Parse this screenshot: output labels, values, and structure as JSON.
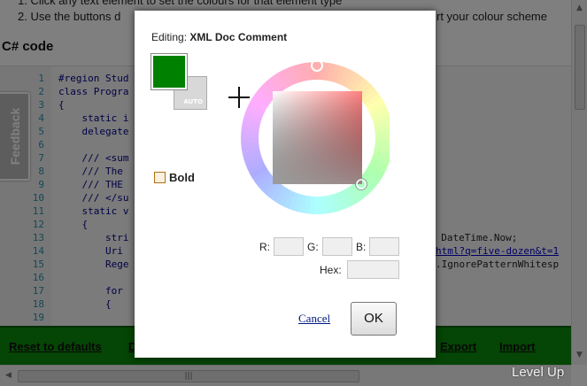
{
  "instructions": {
    "line1": "1.  Click any text element to set the colours for that element type",
    "line2_start": "2.  Use the buttons d",
    "line2_end": "rt your colour scheme"
  },
  "section_title": "C# code",
  "code": {
    "line_numbers": [
      "1",
      "2",
      "3",
      "4",
      "5",
      "6",
      "7",
      "8",
      "9",
      "10",
      "11",
      "12",
      "13",
      "14",
      "15",
      "16",
      "17",
      "18",
      "19"
    ],
    "lines": [
      "#region Stud",
      "class Progra",
      "{",
      "    static i",
      "    delegate",
      "",
      "    /// <sum",
      "    /// The ",
      "    /// THE ",
      "    /// </su",
      "    static v",
      "    {",
      "        stri",
      "        Uri ",
      "        Rege",
      "",
      "        for ",
      "        {",
      ""
    ],
    "right_line13": "+ DateTime.Now;",
    "right_line14": "html?q=five-dozen&t=1",
    "right_line15": ".IgnorePatternWhitesp"
  },
  "footer": {
    "reset": "Reset to defaults",
    "d": "D",
    "export": "Export",
    "import": "Import"
  },
  "scroll": {
    "grip": "|||"
  },
  "feedback": "Feedback",
  "watermark": "Level Up",
  "dialog": {
    "editing_label": "Editing:",
    "element_name": "XML Doc Comment",
    "auto_label": "AUTO",
    "bold_label": "Bold",
    "bold_checked": false,
    "current_color": "#008000",
    "r_label": "R:",
    "g_label": "G:",
    "b_label": "B:",
    "hex_label": "Hex:",
    "r_value": "",
    "g_value": "",
    "b_value": "",
    "hex_value": "",
    "cancel": "Cancel",
    "ok": "OK"
  }
}
